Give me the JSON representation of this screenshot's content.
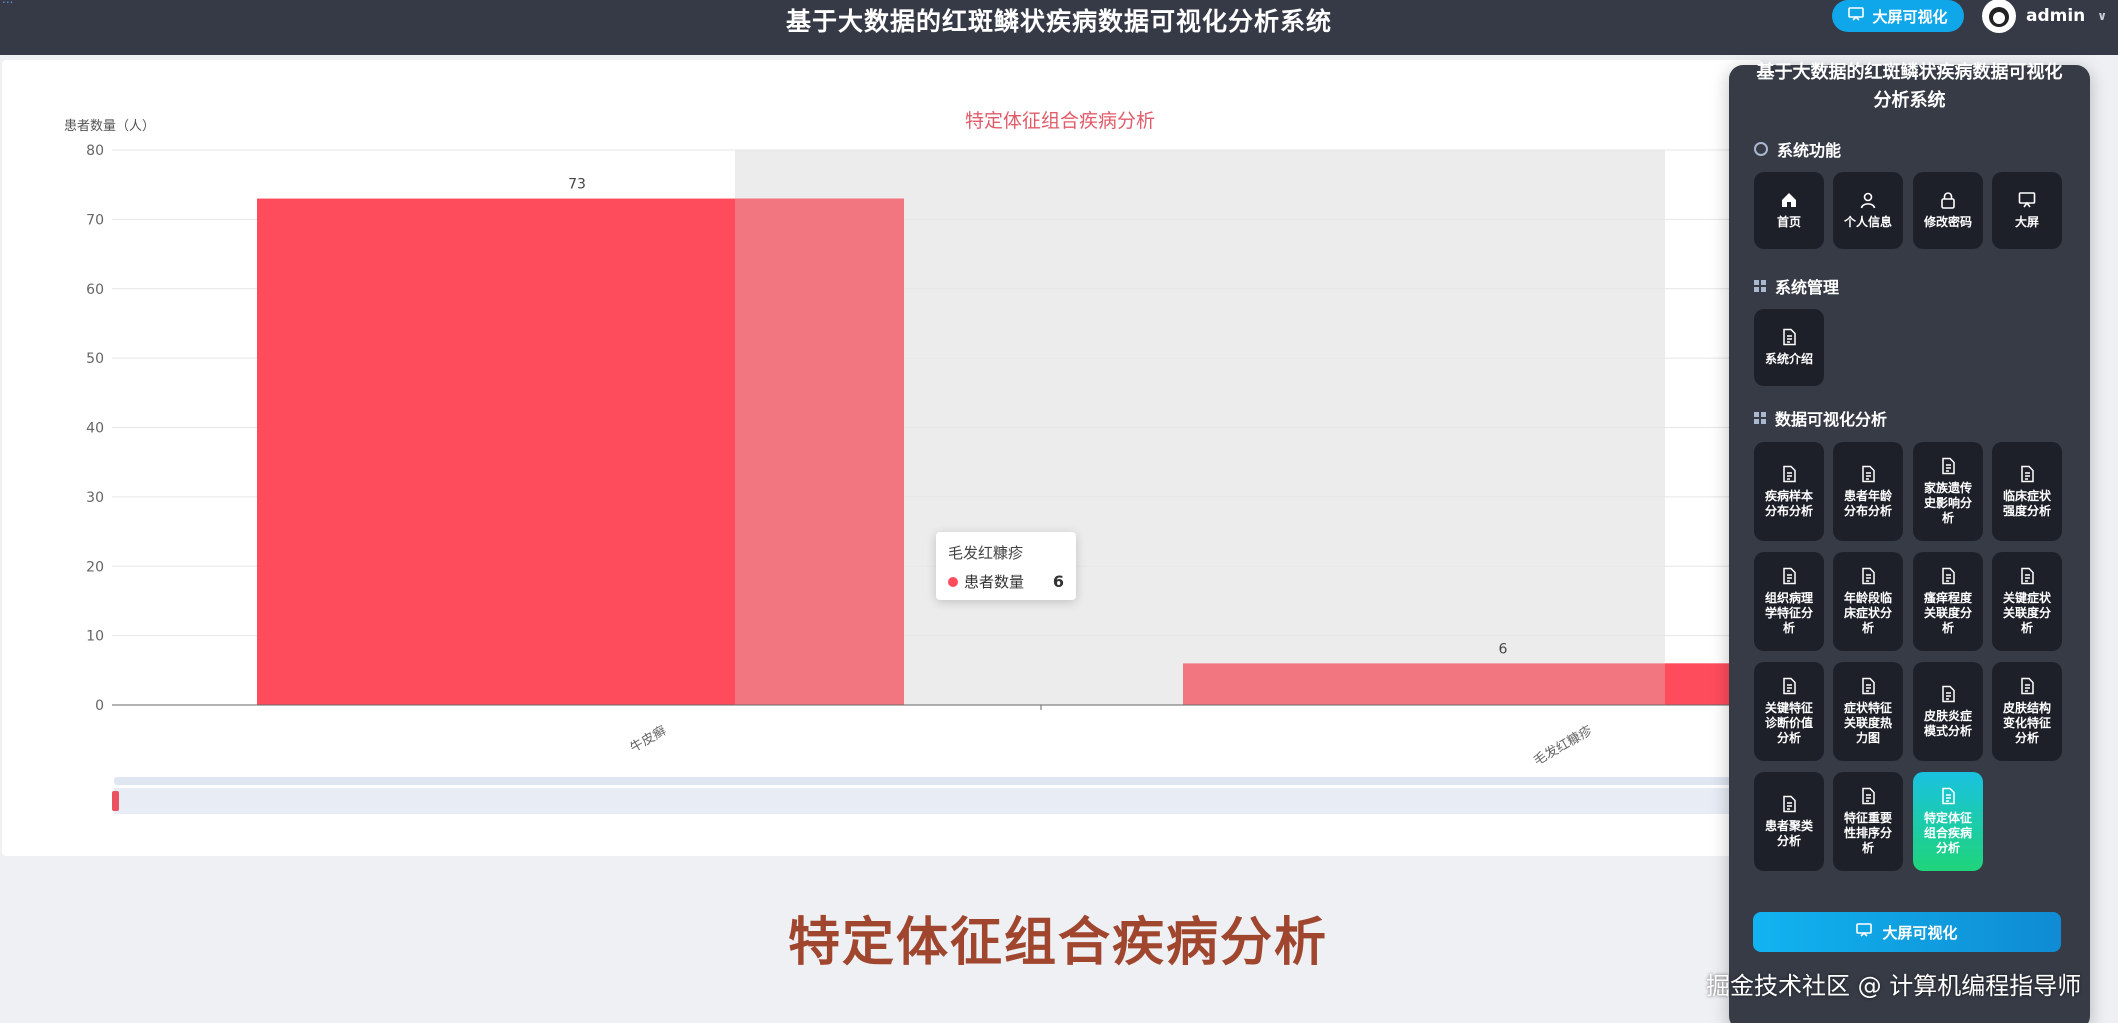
{
  "header": {
    "corner_text": "...",
    "title": "基于大数据的红斑鳞状疾病数据可视化分析系统",
    "bigscreen_button": "大屏可视化",
    "username": "admin"
  },
  "chart_data": {
    "type": "bar",
    "title": "特定体征组合疾病分析",
    "ylabel": "患者数量（人）",
    "ylim": [
      0,
      80
    ],
    "yticks": [
      0,
      10,
      20,
      30,
      40,
      50,
      60,
      70,
      80
    ],
    "categories": [
      "牛皮癣",
      "毛发红糠疹"
    ],
    "series": [
      {
        "name": "患者数量",
        "values": [
          73,
          6
        ]
      }
    ],
    "grid": true,
    "colors": {
      "bar": "#ff4c5c",
      "bar_hover": "#f17680",
      "title": "#e05c6a"
    }
  },
  "tooltip": {
    "category": "毛发红糠疹",
    "series_name": "患者数量",
    "value": "6"
  },
  "caption": "特定体征组合疾病分析",
  "watermark": "掘金技术社区 @ 计算机编程指导师",
  "menu": {
    "title": "基于大数据的红斑鳞状疾病数据可视化分析系统",
    "sections": [
      {
        "title": "系统功能",
        "items": [
          {
            "label": "首页",
            "icon": "home-icon"
          },
          {
            "label": "个人信息",
            "icon": "user-icon"
          },
          {
            "label": "修改密码",
            "icon": "lock-icon"
          },
          {
            "label": "大屏",
            "icon": "screen-icon"
          }
        ]
      },
      {
        "title": "系统管理",
        "items": [
          {
            "label": "系统介绍",
            "icon": "document-icon"
          }
        ]
      },
      {
        "title": "数据可视化分析",
        "items": [
          {
            "label": "疾病样本分布分析",
            "icon": "document-icon"
          },
          {
            "label": "患者年龄分布分析",
            "icon": "document-icon"
          },
          {
            "label": "家族遗传史影响分析",
            "icon": "document-icon"
          },
          {
            "label": "临床症状强度分析",
            "icon": "document-icon"
          },
          {
            "label": "组织病理学特征分析",
            "icon": "document-icon"
          },
          {
            "label": "年龄段临床症状分析",
            "icon": "document-icon"
          },
          {
            "label": "瘙痒程度关联度分析",
            "icon": "document-icon"
          },
          {
            "label": "关键症状关联度分析",
            "icon": "document-icon"
          },
          {
            "label": "关键特征诊断价值分析",
            "icon": "document-icon"
          },
          {
            "label": "症状特征关联度热力图",
            "icon": "document-icon"
          },
          {
            "label": "皮肤炎症模式分析",
            "icon": "document-icon"
          },
          {
            "label": "皮肤结构变化特征分析",
            "icon": "document-icon"
          },
          {
            "label": "患者聚类分析",
            "icon": "document-icon"
          },
          {
            "label": "特征重要性排序分析",
            "icon": "document-icon"
          },
          {
            "label": "特定体征组合疾病分析",
            "icon": "document-icon",
            "active": true
          }
        ]
      }
    ],
    "bottom_button": "大屏可视化"
  }
}
